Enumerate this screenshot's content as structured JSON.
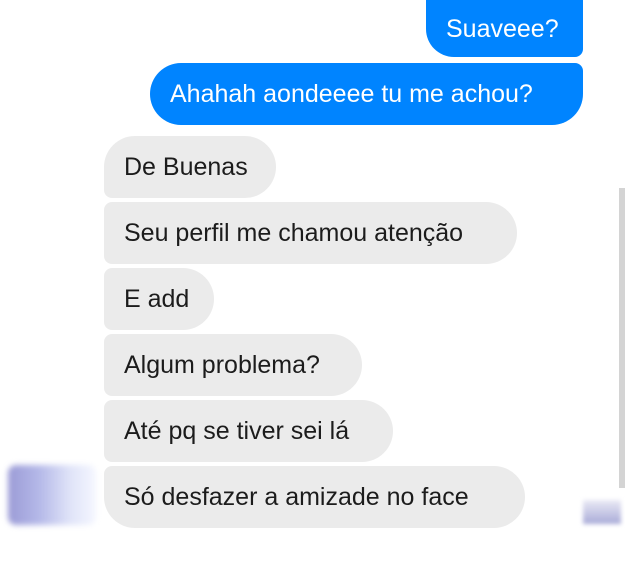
{
  "messages": {
    "sent": [
      "Suaveee?",
      "Ahahah aondeeee tu me achou?"
    ],
    "received": [
      "De Buenas",
      "Seu perfil me chamou atenção",
      "E add",
      "Algum problema?",
      "Até pq se tiver sei lá",
      "Só desfazer a amizade no face"
    ]
  },
  "colors": {
    "sent_bubble": "#0084ff",
    "received_bubble": "#ebebeb",
    "background": "#ffffff"
  }
}
